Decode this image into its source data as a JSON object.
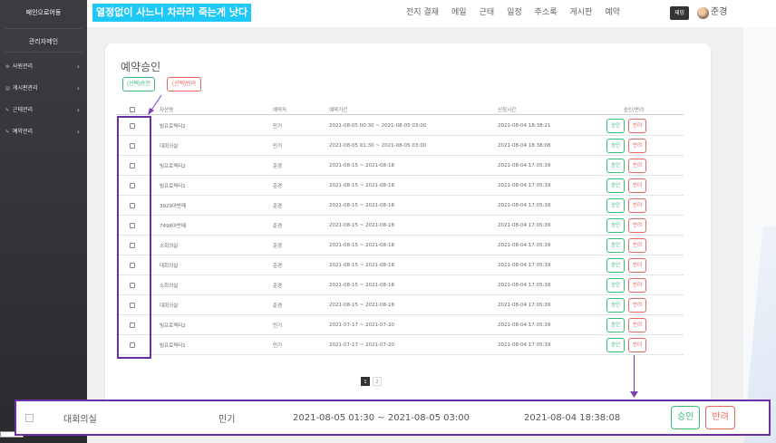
{
  "sidebar": {
    "brand": "페인으로어동",
    "role": "관리자메인",
    "items": [
      {
        "label": "사원관리"
      },
      {
        "label": "게시판관리"
      },
      {
        "label": "근태관리"
      },
      {
        "label": "예약관리"
      }
    ]
  },
  "header": {
    "banner": "열정없이 사느니 차라리 죽는게 낫다",
    "nav": [
      "전지 결재",
      "메일",
      "근태",
      "일정",
      "주소록",
      "게시판",
      "예약"
    ],
    "user_badge": "재밍",
    "user_name": "준경"
  },
  "page": {
    "title": "예약승인",
    "approve_selected": "(선택)승인",
    "reject_selected": "(선택)반려"
  },
  "table": {
    "headers": {
      "room": "자산명",
      "user": "예약자",
      "period": "예약기간",
      "requested": "신청시간",
      "action": "승인/반려"
    },
    "approve_label": "승인",
    "reject_label": "반려",
    "rows": [
      {
        "room": "빔프로젝터2",
        "user": "민기",
        "period": "2021-08-05 00:30 ~ 2021-08-05 03:00",
        "requested": "2021-08-04 18:38:21"
      },
      {
        "room": "대회의실",
        "user": "민기",
        "period": "2021-08-05 01:30 ~ 2021-08-05 03:00",
        "requested": "2021-08-04 18:38:08"
      },
      {
        "room": "빔프로젝터2",
        "user": "준경",
        "period": "2021-08-15 ~ 2021-08-18",
        "requested": "2021-08-04 17:05:39"
      },
      {
        "room": "빔프로젝터1",
        "user": "준경",
        "period": "2021-08-15 ~ 2021-08-18",
        "requested": "2021-08-04 17:05:39"
      },
      {
        "room": "3929아반떼",
        "user": "준경",
        "period": "2021-08-15 ~ 2021-08-18",
        "requested": "2021-08-04 17:05:39"
      },
      {
        "room": "7498아반떼",
        "user": "준경",
        "period": "2021-08-15 ~ 2021-08-18",
        "requested": "2021-08-04 17:05:39"
      },
      {
        "room": "소회의실",
        "user": "준경",
        "period": "2021-08-15 ~ 2021-08-18",
        "requested": "2021-08-04 17:05:39"
      },
      {
        "room": "대회의실",
        "user": "준경",
        "period": "2021-08-15 ~ 2021-08-18",
        "requested": "2021-08-04 17:05:39"
      },
      {
        "room": "소회의실",
        "user": "준경",
        "period": "2021-08-15 ~ 2021-08-18",
        "requested": "2021-08-04 17:05:39"
      },
      {
        "room": "대회의실",
        "user": "준경",
        "period": "2021-08-15 ~ 2021-08-18",
        "requested": "2021-08-04 17:05:39"
      },
      {
        "room": "빔프로젝터2",
        "user": "민기",
        "period": "2021-07-17 ~ 2021-07-20",
        "requested": "2021-08-04 17:05:39"
      },
      {
        "room": "빔프로젝터1",
        "user": "민기",
        "period": "2021-07-17 ~ 2021-07-20",
        "requested": "2021-08-04 17:05:39"
      }
    ]
  },
  "pagination": {
    "pages": [
      "1",
      "2"
    ],
    "current": "1"
  },
  "zoom": {
    "room": "대회의실",
    "user": "민기",
    "period": "2021-08-05 01:30 ~ 2021-08-05 03:00",
    "requested": "2021-08-04 18:38:08",
    "approve_label": "승인",
    "reject_label": "반려"
  },
  "colors": {
    "sidebar": "#2f3035",
    "banner": "#1fc8f5",
    "approve": "#3cb878",
    "reject": "#e8665e",
    "annotation": "#6b2fa8"
  }
}
